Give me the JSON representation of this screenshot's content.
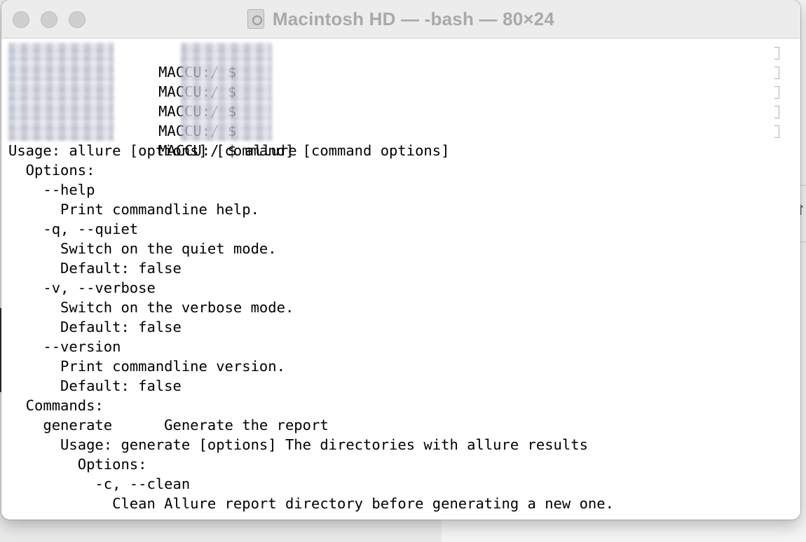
{
  "window": {
    "title": "Macintosh HD — -bash — 80×24",
    "disk_icon": "hard-disk-icon"
  },
  "terminal": {
    "prompt_lines": [
      "MACCU:/ $",
      "MACCU:/ $",
      "MACCU:/ $",
      "MACCU:/ $",
      "MACCU:/ $ allure"
    ],
    "output_lines": [
      "Usage: allure [options] [command] [command options]",
      "  Options:",
      "    --help",
      "      Print commandline help.",
      "    -q, --quiet",
      "      Switch on the quiet mode.",
      "      Default: false",
      "    -v, --verbose",
      "      Switch on the verbose mode.",
      "      Default: false",
      "    --version",
      "      Print commandline version.",
      "      Default: false",
      "  Commands:",
      "    generate      Generate the report",
      "      Usage: generate [options] The directories with allure results",
      "        Options:",
      "          -c, --clean",
      "            Clean Allure report directory before generating a new one."
    ]
  },
  "colors": {
    "title_text": "#a9a9a9",
    "terminal_bg": "#ffffff",
    "terminal_text": "#000000"
  }
}
